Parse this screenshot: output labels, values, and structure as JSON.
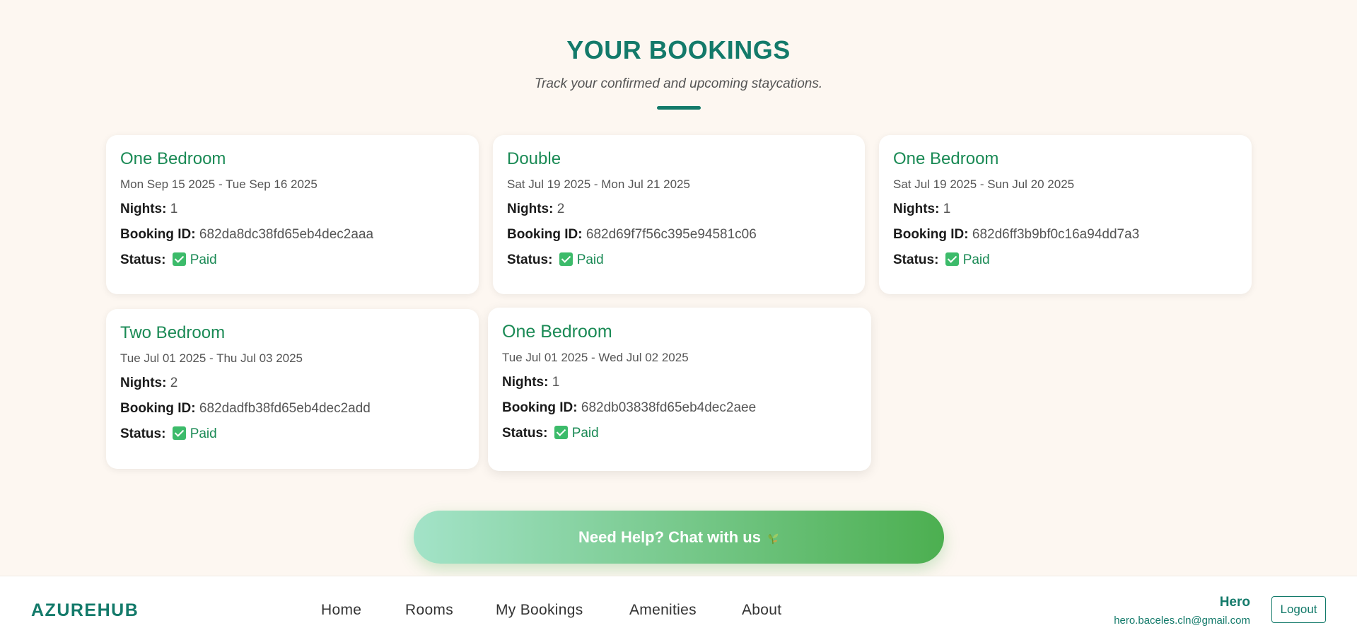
{
  "header": {
    "title": "YOUR BOOKINGS",
    "subtitle": "Track your confirmed and upcoming staycations."
  },
  "labels": {
    "nights": "Nights:",
    "booking_id": "Booking ID:",
    "status": "Status:"
  },
  "bookings": [
    {
      "room": "One Bedroom",
      "dates": "Mon Sep 15 2025 - Tue Sep 16 2025",
      "nights": "1",
      "booking_id": "682da8dc38fd65eb4dec2aaa",
      "status": "Paid"
    },
    {
      "room": "Double",
      "dates": "Sat Jul 19 2025 - Mon Jul 21 2025",
      "nights": "2",
      "booking_id": "682d69f7f56c395e94581c06",
      "status": "Paid"
    },
    {
      "room": "One Bedroom",
      "dates": "Sat Jul 19 2025 - Sun Jul 20 2025",
      "nights": "1",
      "booking_id": "682d6ff3b9bf0c16a94dd7a3",
      "status": "Paid"
    },
    {
      "room": "Two Bedroom",
      "dates": "Tue Jul 01 2025 - Thu Jul 03 2025",
      "nights": "2",
      "booking_id": "682dadfb38fd65eb4dec2add",
      "status": "Paid"
    },
    {
      "room": "One Bedroom",
      "dates": "Tue Jul 01 2025 - Wed Jul 02 2025",
      "nights": "1",
      "booking_id": "682db03838fd65eb4dec2aee",
      "status": "Paid"
    }
  ],
  "help_button": {
    "label": "Need Help? Chat with us",
    "icon": "sprout-icon"
  },
  "footer": {
    "brand": "AZUREHUB",
    "nav": [
      "Home",
      "Rooms",
      "My Bookings",
      "Amenities",
      "About"
    ],
    "user_name": "Hero",
    "user_email": "hero.baceles.cln@gmail.com",
    "logout_label": "Logout"
  },
  "colors": {
    "accent": "#137a6a",
    "room_title": "#1a8a55",
    "status_check": "#3cbb6a",
    "background": "#fdf7f1"
  }
}
